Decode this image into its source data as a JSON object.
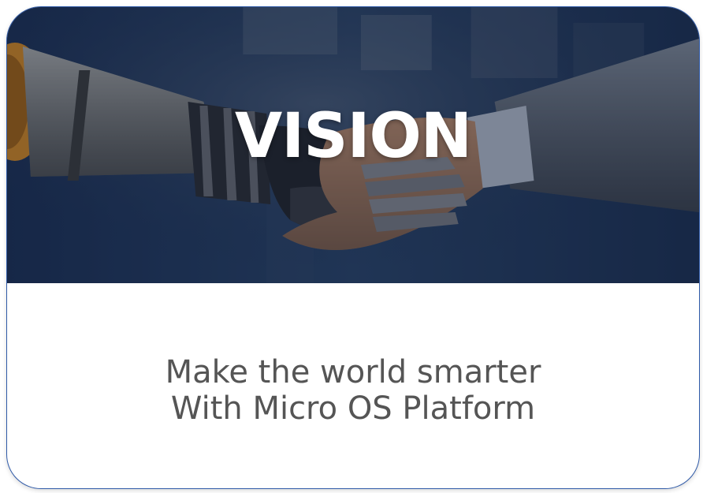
{
  "hero": {
    "title": "VISION",
    "image": "robot-human-handshake"
  },
  "caption": {
    "line1": "Make the world smarter",
    "line2": "With Micro OS Platform"
  },
  "colors": {
    "border": "#2f5aa8",
    "title": "#ffffff",
    "caption": "#555555"
  }
}
